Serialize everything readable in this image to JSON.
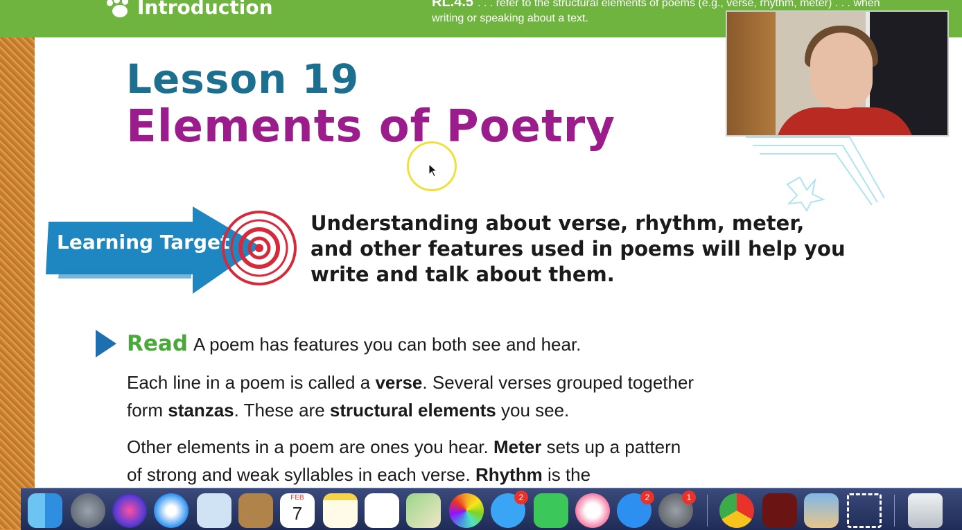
{
  "header": {
    "section_label": "Introduction",
    "standard_code": "RL.4.5",
    "standard_text": ". . .  refer to the structural elements of poems (e.g., verse, rhythm, meter) . . . when",
    "standard_text_line2": "writing or speaking about a text."
  },
  "lesson": {
    "number": "Lesson 19",
    "title": "Elements of Poetry"
  },
  "learning_target": {
    "label": "Learning Target",
    "text": "Understanding about verse, rhythm, meter, and other features used in poems will help you write and talk about them."
  },
  "read": {
    "label": "Read",
    "intro": "A poem has features you can both see and hear.",
    "para1": {
      "t1": "Each line in a poem is called a ",
      "b1": "verse",
      "t2": ". Several verses grouped together form ",
      "b2": "stanzas",
      "t3": ". These are ",
      "b3": "structural elements",
      "t4": " you see."
    },
    "para2": {
      "t1": "Other elements in a poem are ones you hear. ",
      "b1": "Meter",
      "t2": " sets up a pattern of strong and weak syllables in each verse. ",
      "b2": "Rhythm",
      "t3": " is the"
    }
  },
  "dock": {
    "calendar_month": "FEB",
    "calendar_day": "7",
    "messages_badge": "2",
    "appstore_badge": "2",
    "settings_badge": "1",
    "icons": [
      "finder-icon",
      "launchpad-icon",
      "siri-icon",
      "safari-icon",
      "mail-icon",
      "contacts-icon",
      "calendar-icon",
      "notes-icon",
      "reminders-icon",
      "maps-icon",
      "photos-icon",
      "messages-icon",
      "facetime-icon",
      "music-icon",
      "app-store-icon",
      "system-preferences-icon",
      "chrome-icon",
      "flash-icon",
      "preview-icon",
      "screenshot-icon",
      "trash-icon"
    ]
  },
  "colors": {
    "header_green": "#6fb43e",
    "lesson_blue": "#1c6f8f",
    "title_purple": "#9b1d8c",
    "read_green": "#4ba83b",
    "arrow_blue": "#1e86c0"
  }
}
